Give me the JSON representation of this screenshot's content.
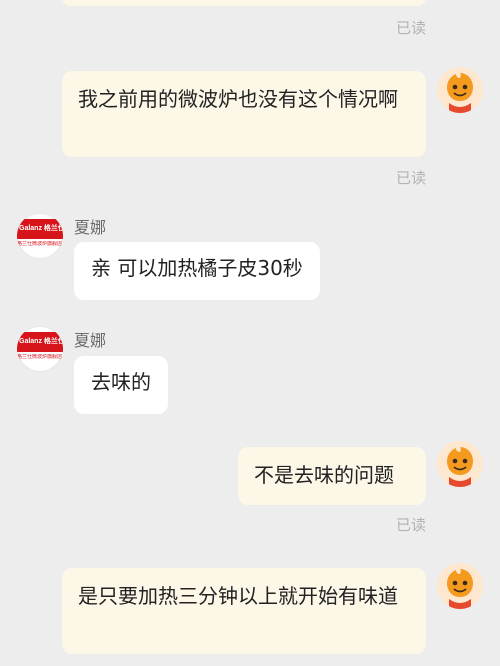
{
  "messages": [
    {
      "side": "out",
      "text": "",
      "read": "已读"
    },
    {
      "side": "out",
      "text": "我之前用的微波炉也没有这个情况啊",
      "read": "已读"
    },
    {
      "side": "in",
      "sender": "夏娜",
      "text": "亲 可以加热橘子皮30秒"
    },
    {
      "side": "in",
      "sender": "夏娜",
      "text": "去味的"
    },
    {
      "side": "out",
      "text": "不是去味的问题",
      "read": "已读"
    },
    {
      "side": "out",
      "text": "是只要加热三分钟以上就开始有味道"
    }
  ],
  "brand": {
    "logo_text": "Galanz 格兰仕",
    "sub_text": "格兰仕微波炉旗舰店 官方授权",
    "color": "#d7141a"
  },
  "colors": {
    "background": "#ededed",
    "outgoing_bubble": "#fdf7e8",
    "incoming_bubble": "#ffffff",
    "read_receipt": "#b3b3b3"
  }
}
